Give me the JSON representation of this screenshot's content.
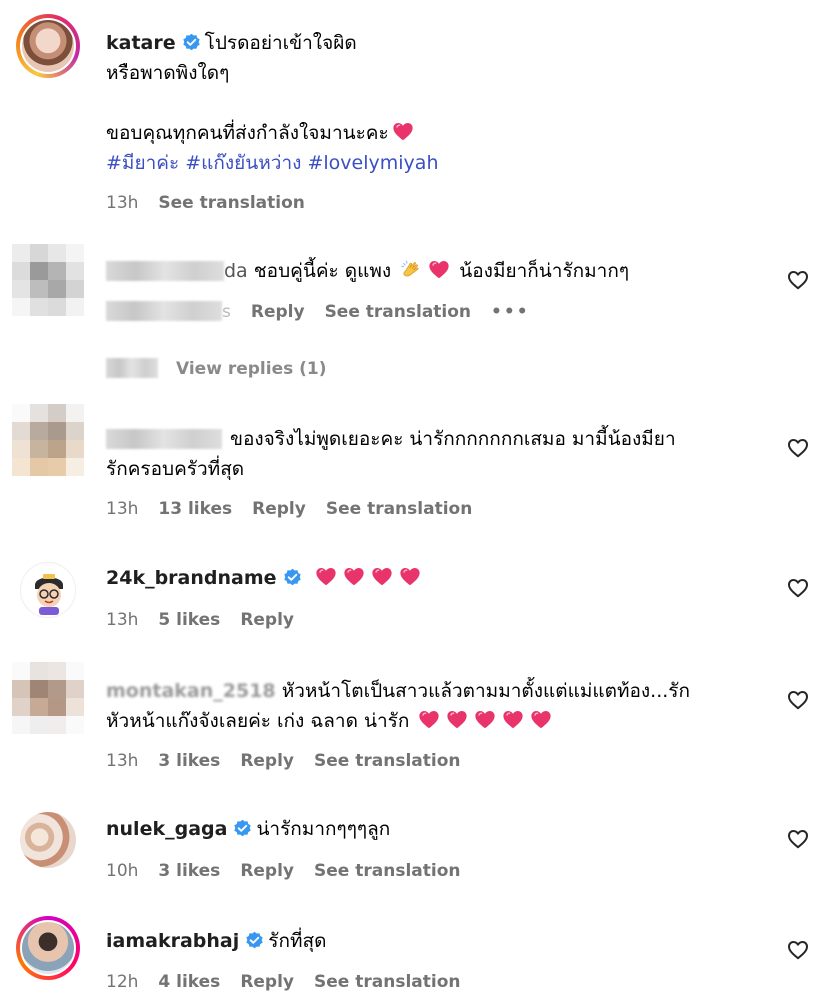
{
  "post": {
    "username": "katare",
    "caption_line1": "โปรดอย่าเข้าใจผิด",
    "caption_line2": "หรือพาดพิงใดๆ",
    "caption_line3": "ขอบคุณทุกคนที่ส่งกำลังใจมานะคะ",
    "hashtags": [
      "#มียาค่ะ",
      "#แก๊งยันหว่าง",
      "#lovelymiyah"
    ],
    "time": "13h",
    "see_translation": "See translation"
  },
  "comments": [
    {
      "username_suffix": "da",
      "text": "ชอบคู่นี้ค่ะ ดูแพง",
      "text_after": "น้องมียาก็น่ารักมากๆ",
      "time_suffix": "s",
      "reply": "Reply",
      "see_translation": "See translation",
      "more": "•••",
      "view_replies": "View replies (1)"
    },
    {
      "text_line1": "ของจริงไม่พูดเยอะคะ น่ารักกกกกกกเสมอ มามี้น้องมียา",
      "text_line2": "รักครอบครัวที่สุด",
      "time": "13h",
      "likes": "13 likes",
      "reply": "Reply",
      "see_translation": "See translation"
    },
    {
      "username": "24k_brandname",
      "time": "13h",
      "likes": "5 likes",
      "reply": "Reply"
    },
    {
      "username": "montakan_2518",
      "text_line1": "หัวหน้าโตเป็นสาวแล้วตามมาตั้งแต่แม่แตท้อง...รัก",
      "text_line2": "หัวหน้าแก๊งจังเลยค่ะ เก่ง ฉลาด น่ารัก",
      "time": "13h",
      "likes": "3 likes",
      "reply": "Reply",
      "see_translation": "See translation"
    },
    {
      "username": "nulek_gaga",
      "text": "น่ารักมากๆๆๆลูก",
      "time": "10h",
      "likes": "3 likes",
      "reply": "Reply",
      "see_translation": "See translation"
    },
    {
      "username": "iamakrabhaj",
      "text": "รักที่สุด",
      "time": "12h",
      "likes": "4 likes",
      "reply": "Reply",
      "see_translation": "See translation"
    }
  ],
  "colors": {
    "verified": "#3897f0",
    "heart": "#e8336b",
    "hashtag": "#3b4fc4",
    "meta": "#737373"
  }
}
